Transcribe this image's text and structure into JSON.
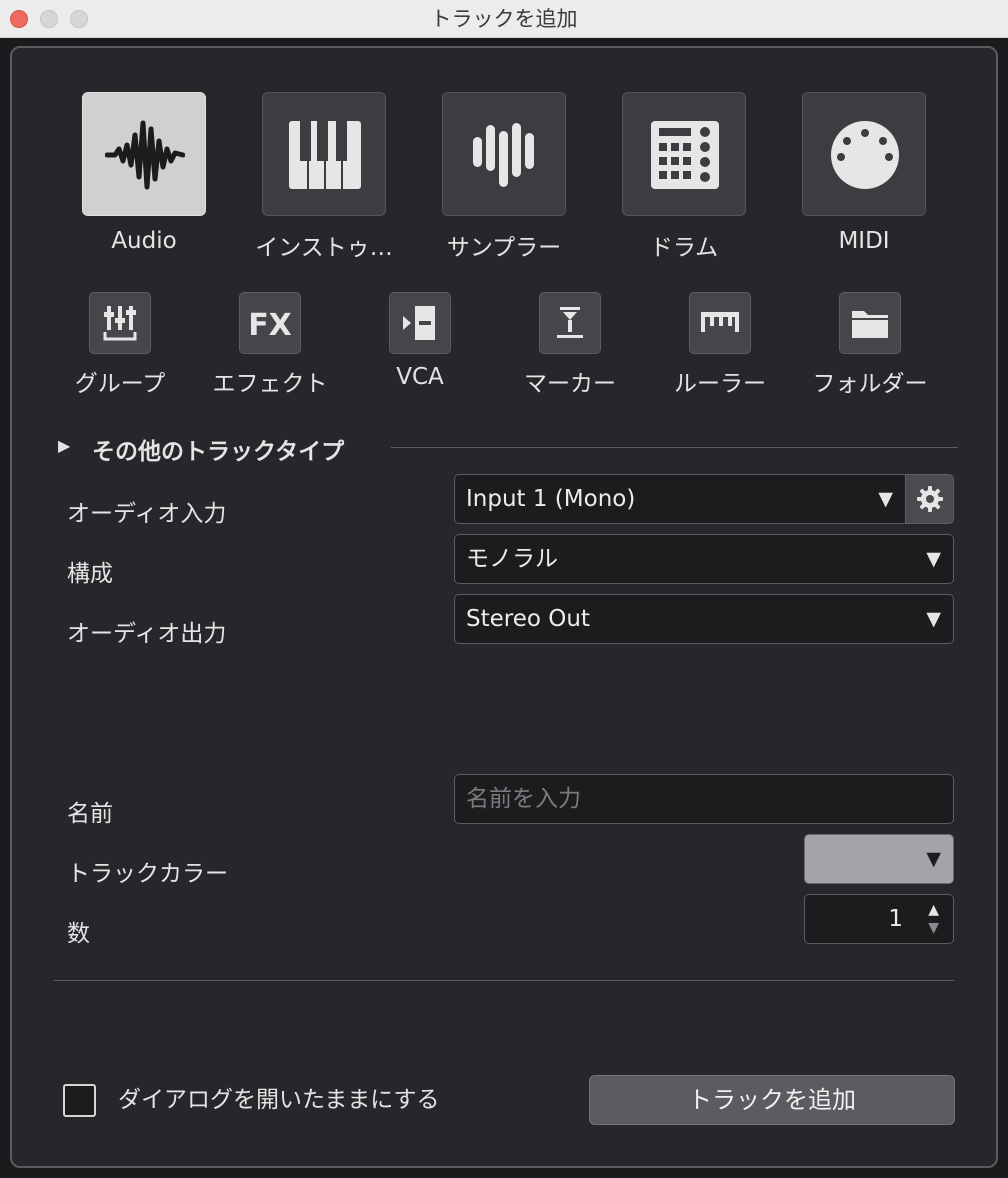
{
  "window": {
    "title": "トラックを追加"
  },
  "track_types": [
    {
      "label": "Audio",
      "icon": "waveform-icon",
      "selected": true
    },
    {
      "label": "インストゥ…",
      "icon": "piano-keys-icon",
      "selected": false
    },
    {
      "label": "サンプラー",
      "icon": "sampler-bars-icon",
      "selected": false
    },
    {
      "label": "ドラム",
      "icon": "drum-pad-icon",
      "selected": false
    },
    {
      "label": "MIDI",
      "icon": "midi-connector-icon",
      "selected": false
    }
  ],
  "small_types": [
    {
      "label": "グループ",
      "icon": "group-faders-icon"
    },
    {
      "label": "エフェクト",
      "icon": "fx-icon"
    },
    {
      "label": "VCA",
      "icon": "vca-icon"
    },
    {
      "label": "マーカー",
      "icon": "marker-icon"
    },
    {
      "label": "ルーラー",
      "icon": "ruler-icon"
    },
    {
      "label": "フォルダー",
      "icon": "folder-icon"
    }
  ],
  "other_types": {
    "label": "その他のトラックタイプ"
  },
  "fields": {
    "audio_input": {
      "label": "オーディオ入力",
      "value": "Input 1 (Mono)"
    },
    "configuration": {
      "label": "構成",
      "value": "モノラル"
    },
    "audio_output": {
      "label": "オーディオ出力",
      "value": "Stereo Out"
    },
    "name": {
      "label": "名前",
      "placeholder": "名前を入力"
    },
    "track_color": {
      "label": "トラックカラー",
      "color": "#a3a4a7"
    },
    "count": {
      "label": "数",
      "value": "1"
    }
  },
  "footer": {
    "keep_open_label": "ダイアログを開いたままにする",
    "add_button_label": "トラックを追加"
  },
  "colors": {
    "panel": "#26272a",
    "selected_tile": "#d0d0d0"
  }
}
